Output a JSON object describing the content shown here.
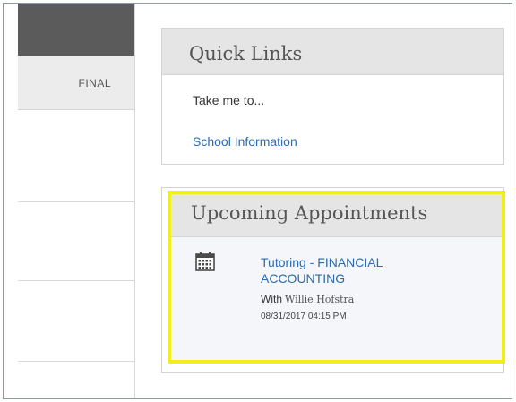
{
  "grade_table": {
    "column_header": "FINAL"
  },
  "quick_links": {
    "title": "Quick Links",
    "prompt": "Take me to...",
    "items": [
      {
        "label": "School Information"
      }
    ]
  },
  "appointments": {
    "title": "Upcoming Appointments",
    "items": [
      {
        "title": "Tutoring - FINANCIAL ACCOUNTING",
        "with_label": "With",
        "with_name": "Willie Hofstra",
        "datetime": "08/31/2017 04:15 PM",
        "icon": "calendar-icon"
      }
    ]
  },
  "colors": {
    "link": "#2a6bb3",
    "highlight": "#f2ee1c",
    "panel_header": "#e5e5e5",
    "dark_header": "#5b5b5b"
  }
}
